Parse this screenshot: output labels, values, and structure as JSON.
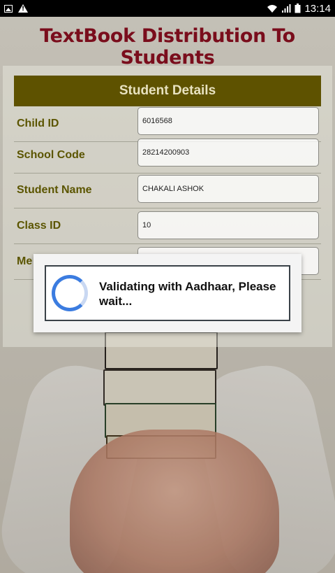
{
  "status_bar": {
    "time": "13:14",
    "icons": [
      "image-notification-icon",
      "warning-icon",
      "wifi-icon",
      "signal-icon",
      "battery-icon"
    ]
  },
  "app": {
    "title": "TextBook Distribution To Students"
  },
  "form": {
    "header": "Student Details",
    "fields": [
      {
        "label": "Child ID",
        "value": "6016568"
      },
      {
        "label": "School Code",
        "value": "28214200903"
      },
      {
        "label": "Student Name",
        "value": "CHAKALI ASHOK"
      },
      {
        "label": "Class ID",
        "value": "10"
      },
      {
        "label": "Me",
        "value": ""
      }
    ]
  },
  "dialog": {
    "message": "Validating with Aadhaar, Please wait..."
  },
  "colors": {
    "title": "#7a0d1c",
    "header_bg": "#5e5200",
    "label": "#5b5500",
    "spinner": "#3b7ce0"
  }
}
